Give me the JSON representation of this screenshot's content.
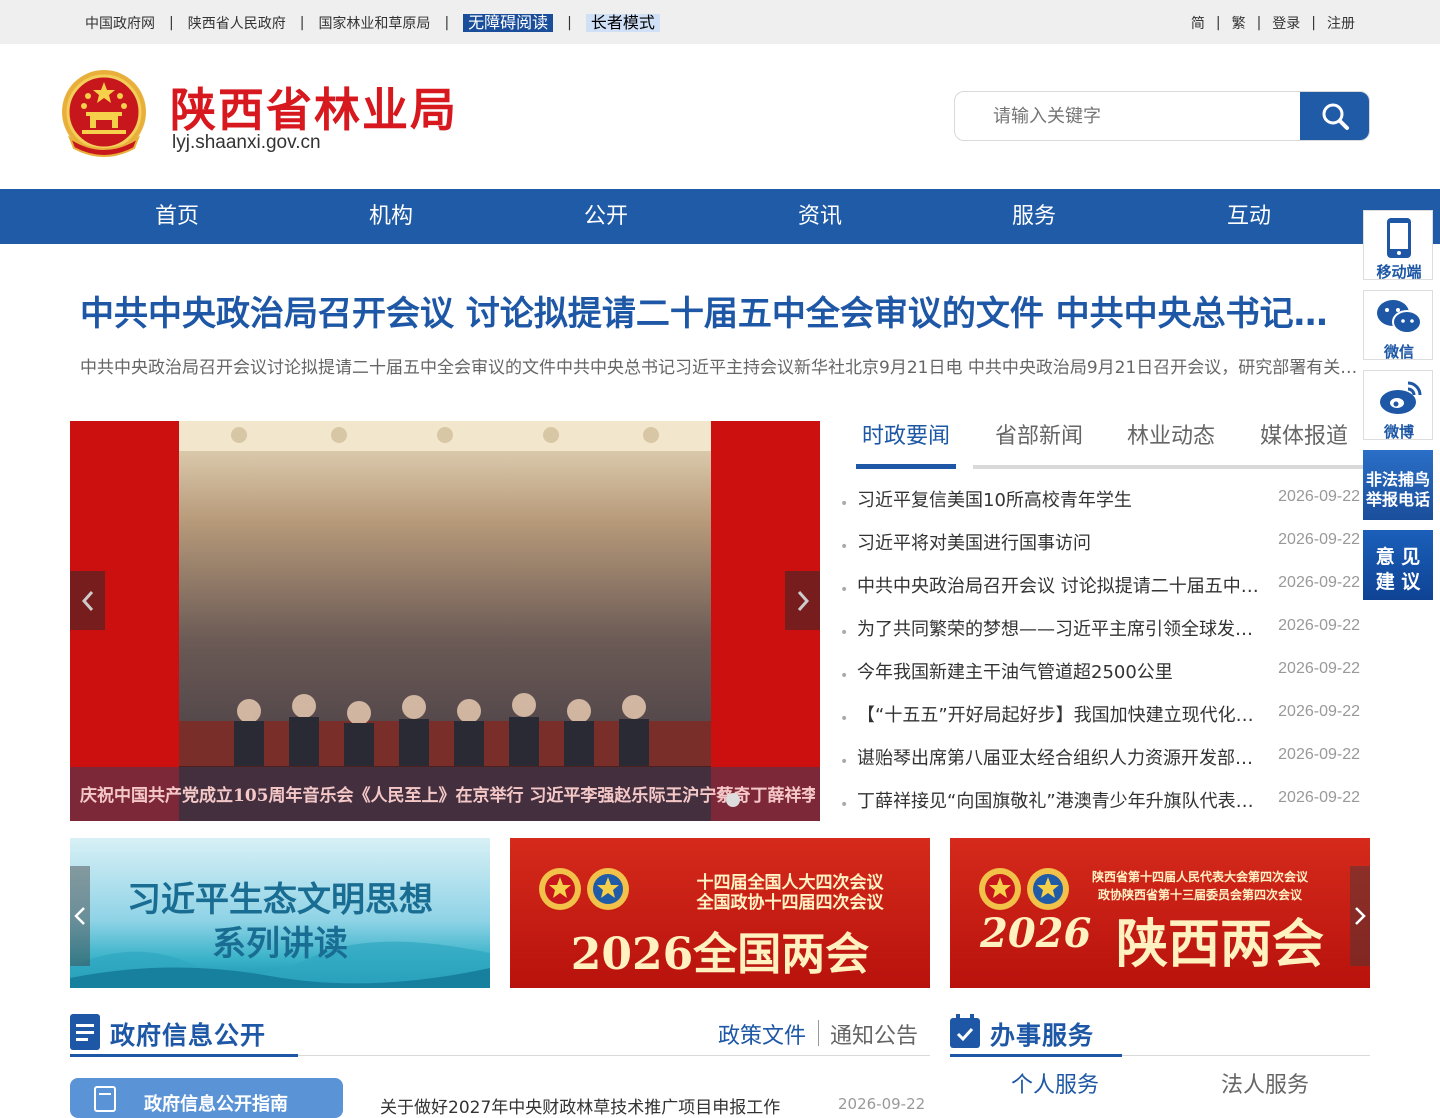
{
  "topbar": {
    "links": [
      "中国政府网",
      "陕西省人民政府",
      "国家林业和草原局"
    ],
    "accessible_reading": "无障碍阅读",
    "elder_mode": "长者模式",
    "simplified": "简",
    "traditional": "繁",
    "login": "登录",
    "register": "注册"
  },
  "header": {
    "title": "陕西省林业局",
    "domain": "lyj.shaanxi.gov.cn",
    "search_placeholder": "请输入关键字"
  },
  "nav": [
    "首页",
    "机构",
    "公开",
    "资讯",
    "服务",
    "互动"
  ],
  "headline": {
    "title": "中共中央政治局召开会议 讨论拟提请二十届五中全会审议的文件 中共中央总书记习近平主持会议",
    "summary": "中共中央政治局召开会议讨论拟提请二十届五中全会审议的文件中共中央总书记习近平主持会议新华社北京9月21日电  中共中央政治局9月21日召开会议，研究部署有关工作"
  },
  "carousel": {
    "caption": "庆祝中国共产党成立105周年音乐会《人民至上》在京举行 习近平李强赵乐际王沪宁蔡奇丁薛祥李希韩正"
  },
  "news_tabs": [
    "时政要闻",
    "省部新闻",
    "林业动态",
    "媒体报道"
  ],
  "news": [
    {
      "title": "习近平复信美国10所高校青年学生",
      "date": "2026-09-22"
    },
    {
      "title": "习近平将对美国进行国事访问",
      "date": "2026-09-22"
    },
    {
      "title": "中共中央政治局召开会议 讨论拟提请二十届五中全会审议的文件",
      "date": "2026-09-22"
    },
    {
      "title": "为了共同繁荣的梦想——习近平主席引领全球发展倡议",
      "date": "2026-09-22"
    },
    {
      "title": "今年我国新建主干油气管道超2500公里",
      "date": "2026-09-22"
    },
    {
      "title": "【“十五五”开好局起好步】我国加快建立现代化粮食储备体系",
      "date": "2026-09-22"
    },
    {
      "title": "谌贻琴出席第八届亚太经合组织人力资源开发部长级会议",
      "date": "2026-09-22"
    },
    {
      "title": "丁薛祥接见“向国旗敬礼”港澳青少年升旗队代表访问团",
      "date": "2026-09-22"
    }
  ],
  "banners": {
    "b1_line1": "习近平生态文明思想",
    "b1_line2": "系列讲读",
    "b2_small1": "十四届全国人大四次会议",
    "b2_small2": "全国政协十四届四次会议",
    "b2_big": "2026全国两会",
    "b3_small1": "陕西省第十四届人民代表大会第四次会议",
    "b3_small2": "政协陕西省第十三届委员会第四次会议",
    "b3_big_num": "2026",
    "b3_big": "陕西两会"
  },
  "sections": {
    "gov_info": "政府信息公开",
    "gov_tab1": "政策文件",
    "gov_tab2": "通知公告",
    "gov_guide": "政府信息公开指南",
    "gov_first_item": "关于做好2027年中央财政林草技术推广项目申报工作",
    "gov_first_date": "2026-09-22",
    "service": "办事服务",
    "service_tab1": "个人服务",
    "service_tab2": "法人服务"
  },
  "sidebar": {
    "mobile": "移动端",
    "wechat": "微信",
    "weibo": "微博",
    "report_l1": "非法捕鸟",
    "report_l2": "举报电话",
    "advice_l1": "意 见",
    "advice_l2": "建 议"
  },
  "colors": {
    "brand_blue": "#1f5ba6",
    "title_red": "#d7181e",
    "banner_red": "#c8160f"
  }
}
